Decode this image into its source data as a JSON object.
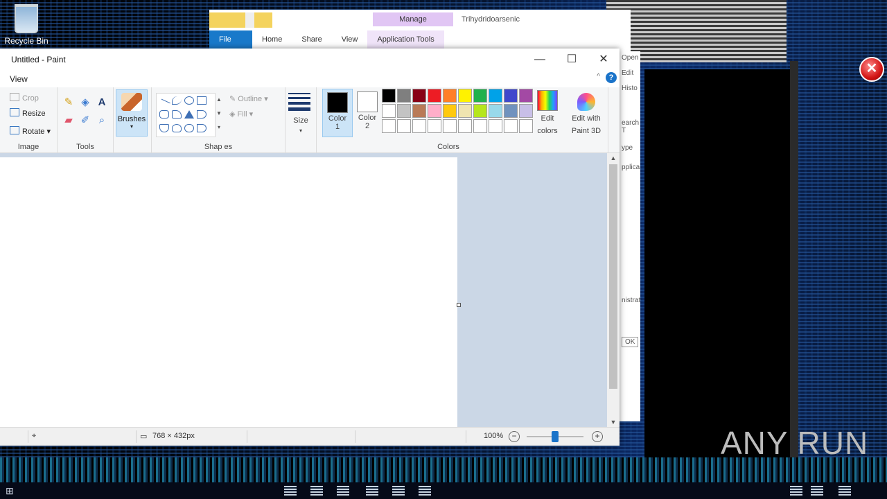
{
  "desktop": {
    "recycle_bin_label": "Recycle Bin",
    "watermark": "ANY RUN"
  },
  "explorer": {
    "context_tab": "Manage",
    "window_title": "Trihydridoarsenic",
    "tabs": [
      "File",
      "Home",
      "Share",
      "View",
      "Application Tools"
    ]
  },
  "side_window": {
    "items": [
      "Open",
      "Edit",
      "Histo",
      "earch T",
      "ype",
      "pplica",
      "nistrat",
      "OK"
    ]
  },
  "paint": {
    "title": "Untitled - Paint",
    "menu_view": "View",
    "help_label": "?",
    "groups": {
      "image": {
        "label": "Image",
        "crop": "Crop",
        "resize": "Resize",
        "rotate": "Rotate"
      },
      "tools": {
        "label": "Tools"
      },
      "brushes": {
        "label": "Brushes"
      },
      "shapes": {
        "label": "Shap es",
        "outline": "Outline",
        "fill": "Fill"
      },
      "size": {
        "label": "Size"
      },
      "colors": {
        "label": "Colors",
        "color1_label": "Color",
        "color1_num": "1",
        "color2_label": "Color",
        "color2_num": "2",
        "edit_colors_line1": "Edit",
        "edit_colors_line2": "colors",
        "paint3d_line1": "Edit with",
        "paint3d_line2": "Paint 3D",
        "palette": [
          "#000000",
          "#7f7f7f",
          "#880015",
          "#ed1c24",
          "#ff7f27",
          "#fff200",
          "#22b14c",
          "#00a2e8",
          "#3f48cc",
          "#a349a4",
          "#ffffff",
          "#c3c3c3",
          "#b97a57",
          "#ffaec9",
          "#ffc90e",
          "#efe4b0",
          "#b5e61d",
          "#99d9ea",
          "#7092be",
          "#c8bfe7",
          "#ffffff",
          "#ffffff",
          "#ffffff",
          "#ffffff",
          "#ffffff",
          "#ffffff",
          "#ffffff",
          "#ffffff",
          "#ffffff",
          "#ffffff"
        ],
        "color1_value": "#000000",
        "color2_value": "#ffffff"
      }
    },
    "status": {
      "canvas_size": "768 × 432px",
      "zoom": "100%"
    }
  }
}
